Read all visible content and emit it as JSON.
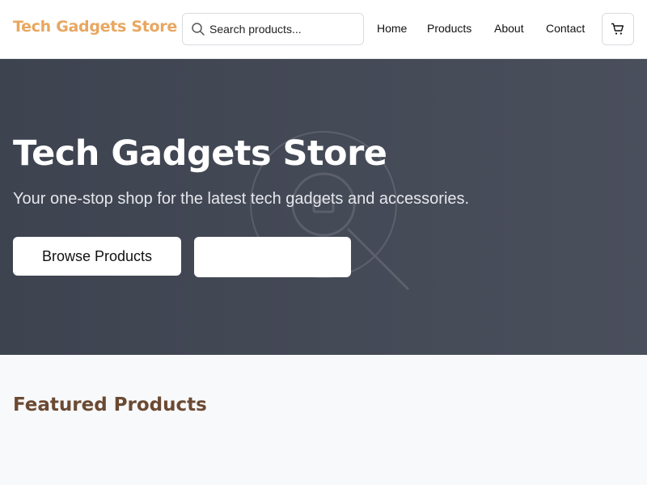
{
  "colors": {
    "brand": "#E8A761",
    "section_heading": "#6B4A33",
    "hero_bg": "#434855"
  },
  "header": {
    "logo": "Tech Gadgets Store",
    "search": {
      "placeholder": "Search products...",
      "value": "",
      "icon": "search-icon"
    },
    "nav": [
      {
        "label": "Home"
      },
      {
        "label": "Products"
      },
      {
        "label": "About"
      },
      {
        "label": "Contact"
      }
    ],
    "cart": {
      "icon": "cart-icon"
    }
  },
  "hero": {
    "title": "Tech Gadgets Store",
    "subtitle": "Your one-stop shop for the latest tech gadgets and accessories.",
    "primary_button": "Browse Products",
    "secondary_button": ""
  },
  "featured": {
    "heading": "Featured Products"
  }
}
